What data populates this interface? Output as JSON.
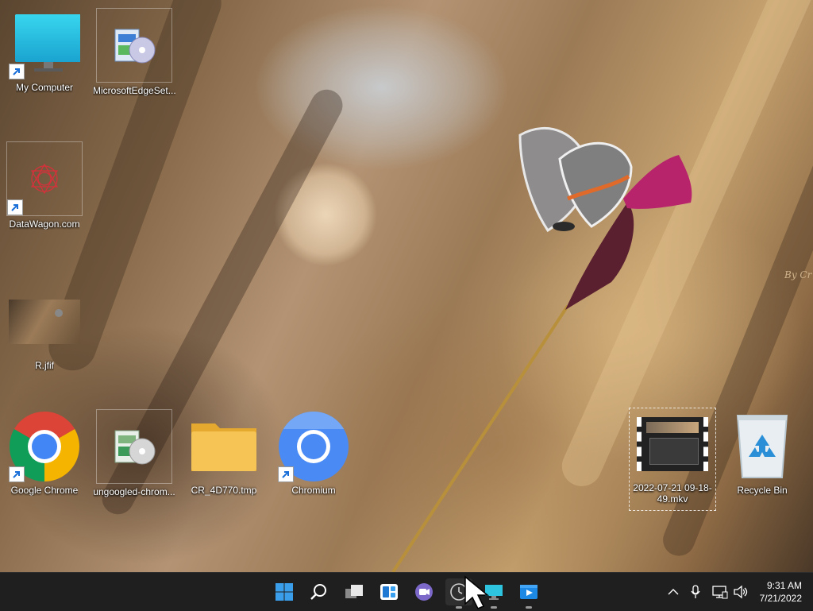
{
  "desktop": {
    "icons": [
      {
        "label": "My Computer"
      },
      {
        "label": "MicrosoftEdgeSet..."
      },
      {
        "label": "DataWagon.com"
      },
      {
        "label": "R.jfif"
      },
      {
        "label": "Google Chrome"
      },
      {
        "label": "ungoogled-chrom..."
      },
      {
        "label": "CR_4D770.tmp"
      },
      {
        "label": "Chromium"
      },
      {
        "label": "2022-07-21 09-18-49.mkv"
      },
      {
        "label": "Recycle Bin"
      }
    ],
    "watermark": "By Cr"
  },
  "taskbar": {
    "apps": [
      "start-icon",
      "search-icon",
      "task-view-icon",
      "widgets-icon",
      "teams-chat-icon",
      "clock-app-icon",
      "remote-desktop-icon",
      "media-player-icon"
    ],
    "tray": [
      "chevron-up-icon",
      "microphone-icon",
      "network-icon",
      "volume-icon"
    ],
    "time": "9:31 AM",
    "date": "7/21/2022"
  },
  "colors": {
    "taskbar": "#1f1f1f",
    "chrome_red": "#db4437",
    "chrome_yellow": "#f4b400",
    "chrome_green": "#0f9d58",
    "chrome_blue": "#4285f4",
    "chromium_blue": "#4a8af4",
    "folder": "#f6c454"
  }
}
